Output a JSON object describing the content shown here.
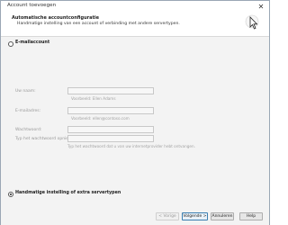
{
  "window": {
    "title": "Account toevoegen",
    "close_glyph": "✕"
  },
  "header": {
    "title": "Automatische accountconfiguratie",
    "subtitle": "Handmatige instelling van een account of verbinding met andere servertypen."
  },
  "options": {
    "email_account": {
      "label": "E-mailaccount",
      "selected": false
    },
    "manual": {
      "label": "Handmatige instelling of extra servertypen",
      "selected": true
    }
  },
  "form": {
    "name": {
      "label": "Uw naam:",
      "hint": "Voorbeeld: Ellen Adams"
    },
    "email": {
      "label": "E-mailadres:",
      "hint": "Voorbeeld: ellen@contoso.com"
    },
    "password": {
      "label": "Wachtwoord:"
    },
    "password_confirm": {
      "label": "Typ het wachtwoord opnieuw:",
      "hint": "Typ het wachtwoord dat u van uw internetprovider hebt ontvangen."
    }
  },
  "buttons": {
    "back": "< Vorige",
    "next": "Volgende >",
    "cancel": "Annuleren",
    "help": "Help"
  },
  "colors": {
    "accent": "#3c7fb1",
    "background": "#f3f3f3"
  }
}
